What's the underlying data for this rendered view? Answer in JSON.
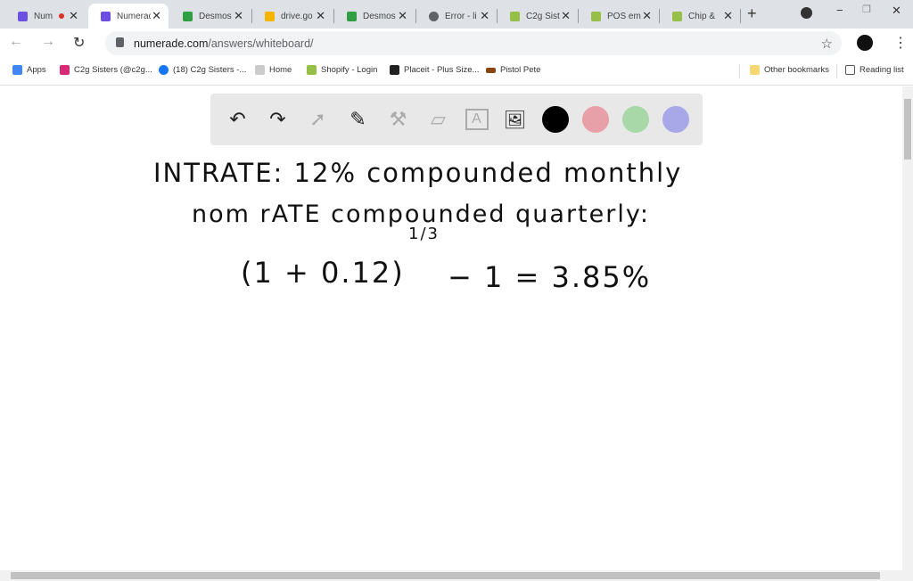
{
  "tabs": [
    {
      "label": "Num",
      "icon": "numerade-icon",
      "color": "#6c4fe0",
      "recording": true
    },
    {
      "label": "Numerade",
      "icon": "numerade-icon",
      "color": "#6c4fe0",
      "active": true
    },
    {
      "label": "Desmos",
      "icon": "desmos-icon",
      "color": "#2f9e44"
    },
    {
      "label": "drive.go",
      "icon": "google-drive-icon",
      "color": "#f4b400"
    },
    {
      "label": "Desmos",
      "icon": "desmos-icon",
      "color": "#2f9e44"
    },
    {
      "label": "Error - li",
      "icon": "globe-icon",
      "color": "#5f6368"
    },
    {
      "label": "C2g Sist",
      "icon": "shopify-icon",
      "color": "#95bf47"
    },
    {
      "label": "POS em",
      "icon": "shopify-icon",
      "color": "#95bf47"
    },
    {
      "label": "Chip & ",
      "icon": "shopify-icon",
      "color": "#95bf47"
    }
  ],
  "address": {
    "host": "numerade.com",
    "path": "/answers/whiteboard/"
  },
  "bookmarks": [
    {
      "label": "Apps",
      "color": "#4285f4"
    },
    {
      "label": "C2g Sisters (@c2g...",
      "color": "#d62976"
    },
    {
      "label": "(18) C2g Sisters -...",
      "color": "#1877f2"
    },
    {
      "label": "Home",
      "color": "#888"
    },
    {
      "label": "Shopify - Login",
      "color": "#95bf47"
    },
    {
      "label": "Placeit - Plus Size...",
      "color": "#222"
    },
    {
      "label": "Pistol Pete",
      "color": "#8b4513"
    }
  ],
  "other_bookmarks": "Other bookmarks",
  "reading_list": "Reading list",
  "whiteboard": {
    "colors": [
      "#000000",
      "#e8a0a8",
      "#a8d8a8",
      "#a8a8e8"
    ],
    "lines": [
      "INTRATE: 12% compounded monthly",
      "nom rATE compounded quarterly:",
      "(1 + 0.12)",
      "1/3",
      "− 1  =  3.85%"
    ]
  }
}
